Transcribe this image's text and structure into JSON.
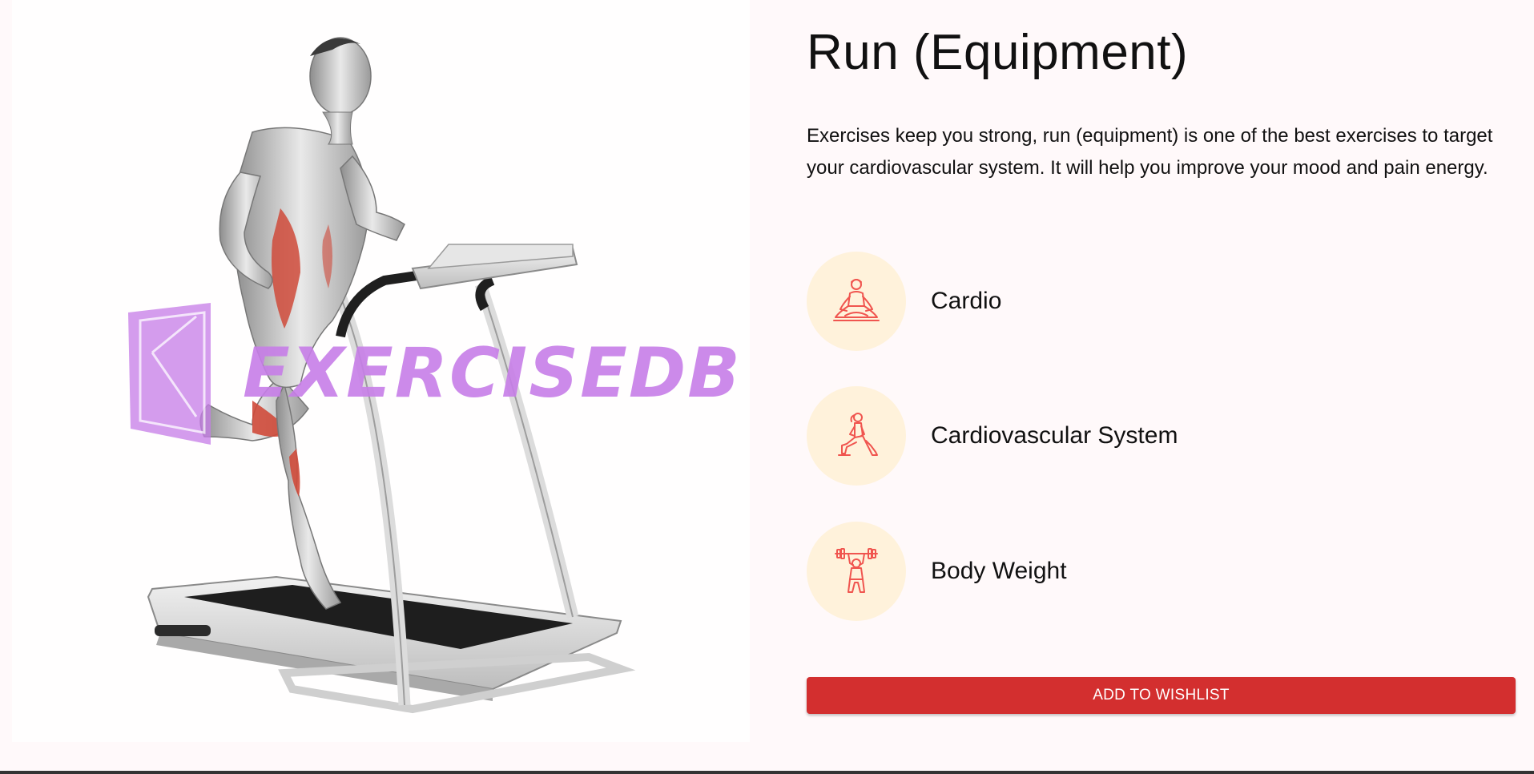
{
  "exercise": {
    "title": "Run (Equipment)",
    "description": "Exercises keep you strong, run (equipment) is one of the best exercises to target your cardiovascular system. It will help you improve your mood and pain energy.",
    "image_watermark": "EXERCISEDB"
  },
  "tags": [
    {
      "icon": "meditation-icon",
      "label": "Cardio"
    },
    {
      "icon": "lunge-icon",
      "label": "Cardiovascular System"
    },
    {
      "icon": "weightlifter-icon",
      "label": "Body Weight"
    }
  ],
  "actions": {
    "wishlist_label": "ADD TO WISHLIST"
  },
  "colors": {
    "accent": "#d32f2f",
    "tag_circle": "#fff2db",
    "icon_stroke": "#f0554f",
    "highlight_muscle": "#cf4a3a",
    "watermark": "#c77ee8",
    "page_background": "#fff9fa"
  }
}
